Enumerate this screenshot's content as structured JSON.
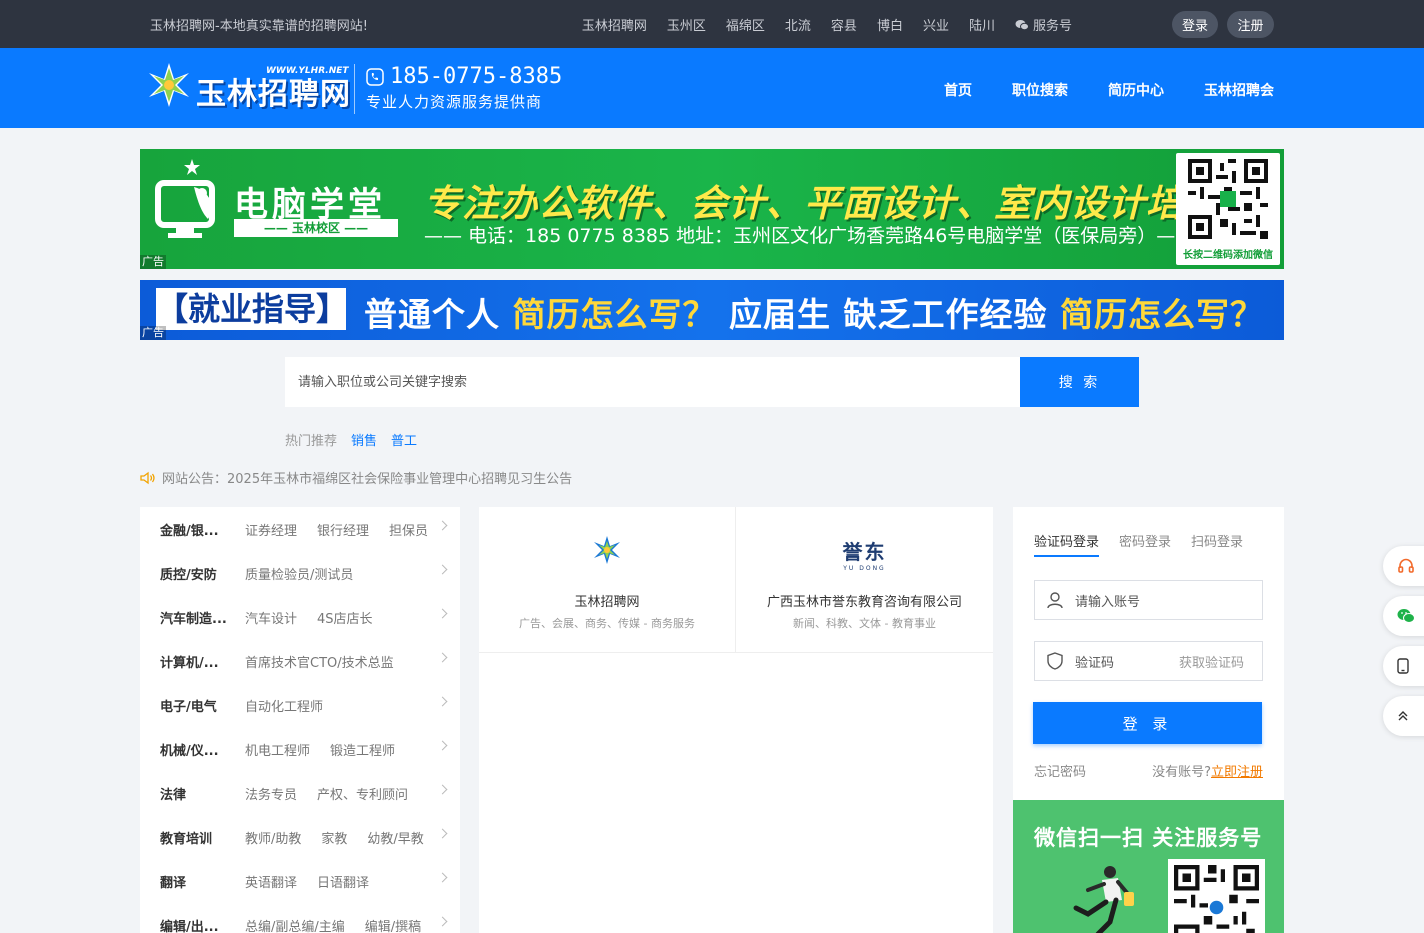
{
  "topbar": {
    "slogan": "玉林招聘网-本地真实靠谱的招聘网站!",
    "links": [
      "玉林招聘网",
      "玉州区",
      "福绵区",
      "北流",
      "容县",
      "博白",
      "兴业",
      "陆川"
    ],
    "service": "服务号",
    "login": "登录",
    "register": "注册"
  },
  "header": {
    "logo_text": "玉林招聘网",
    "logo_site": "WWW.YLHR.NET",
    "phone": "185-0775-8385",
    "tagline": "专业人力资源服务提供商",
    "nav": [
      "首页",
      "职位搜索",
      "简历中心",
      "玉林招聘会"
    ]
  },
  "ad1": {
    "brand": "电脑学堂",
    "campus": "—— 玉林校区 ——",
    "slogan": "专注办公软件、会计、平面设计、室内设计培训",
    "info": "—— 电话：185 0775 8385   地址：玉州区文化广场香莞路46号电脑学堂（医保局旁）——",
    "qr_caption": "长按二维码添加微信",
    "label": "广告"
  },
  "ad2": {
    "box": "【就业指导】",
    "text_1": "普通个人 ",
    "text_2": "简历怎么写？",
    "text_3": " 应届生 缺乏工作经验 ",
    "text_4": "简历怎么写？",
    "label": "广告"
  },
  "search": {
    "placeholder": "请输入职位或公司关键字搜索",
    "button": "搜 索",
    "hot_label": "热门推荐",
    "hot": [
      "销售",
      "普工"
    ]
  },
  "notice": {
    "label": "网站公告：",
    "text": "2025年玉林市福绵区社会保险事业管理中心招聘见习生公告"
  },
  "categories": [
    {
      "title": "金融/银...",
      "subs": [
        "证券经理",
        "银行经理",
        "担保员"
      ]
    },
    {
      "title": "质控/安防",
      "subs": [
        "质量检验员/测试员"
      ]
    },
    {
      "title": "汽车制造...",
      "subs": [
        "汽车设计",
        "4S店店长"
      ]
    },
    {
      "title": "计算机/...",
      "subs": [
        "首席技术官CTO/技术总监"
      ]
    },
    {
      "title": "电子/电气",
      "subs": [
        "自动化工程师"
      ]
    },
    {
      "title": "机械/仪...",
      "subs": [
        "机电工程师",
        "锻造工程师"
      ]
    },
    {
      "title": "法律",
      "subs": [
        "法务专员",
        "产权、专利顾问"
      ]
    },
    {
      "title": "教育培训",
      "subs": [
        "教师/助教",
        "家教",
        "幼教/早教"
      ]
    },
    {
      "title": "翻译",
      "subs": [
        "英语翻译",
        "日语翻译"
      ]
    },
    {
      "title": "编辑/出...",
      "subs": [
        "总编/副总编/主编",
        "编辑/撰稿"
      ]
    }
  ],
  "companies": [
    {
      "name": "玉林招聘网",
      "desc": "广告、会展、商务、传媒 - 商务服务",
      "logo_text": "玉林招聘网"
    },
    {
      "name": "广西玉林市誉东教育咨询有限公司",
      "desc": "新闻、科教、文体 - 教育事业",
      "logo_text": "誉东",
      "logo_sub": "YU DONG"
    }
  ],
  "login": {
    "tabs": [
      "验证码登录",
      "密码登录",
      "扫码登录"
    ],
    "account_placeholder": "请输入账号",
    "code_placeholder": "验证码",
    "get_code": "获取验证码",
    "button": "登 录",
    "forgot": "忘记密码",
    "no_account": "没有账号?",
    "register_now": "立即注册"
  },
  "wechat": {
    "title": "微信扫一扫 关注服务号"
  },
  "colors": {
    "primary": "#0a7aff",
    "topbar": "#2e3440",
    "accent": "#f27a00",
    "wechat": "#4ec26f"
  }
}
